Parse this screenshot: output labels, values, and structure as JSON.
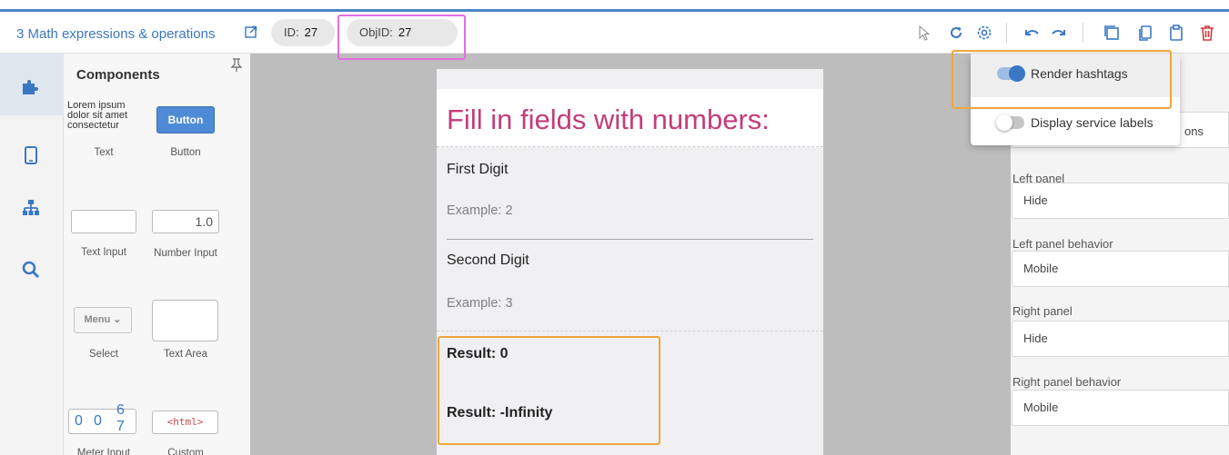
{
  "header": {
    "project_title": "3 Math expressions & operations",
    "id_label": "ID:",
    "id_value": "27",
    "objid_label": "ObjID:",
    "objid_value": "27"
  },
  "toolbar": {
    "icons": [
      "pointer-icon",
      "refresh-icon",
      "settings-gear-icon",
      "undo-icon",
      "redo-icon",
      "duplicate-icon",
      "copy-icon",
      "paste-icon",
      "delete-icon"
    ],
    "delete_color": "#d23b3b",
    "accent_color": "#3b78c4"
  },
  "rail": {
    "items": [
      "components-puzzle-icon",
      "device-mobile-icon",
      "hierarchy-icon",
      "search-icon"
    ]
  },
  "components": {
    "title": "Components",
    "text_sample": "Lorem ipsum dolor sit amet consectetur",
    "text_label": "Text",
    "button_sample": "Button",
    "button_label": "Button",
    "text_input_label": "Text Input",
    "number_input_sample": "1.0",
    "number_input_label": "Number Input",
    "select_sample": "Menu",
    "select_label": "Select",
    "text_area_label": "Text Area",
    "meter_digits": [
      "0",
      "0",
      "6",
      "7"
    ],
    "meter_label": "Meter Input",
    "custom_sample": "<html>",
    "custom_label": "Custom"
  },
  "canvas": {
    "heading": "Fill in fields with numbers:",
    "field1_label": "First Digit",
    "field1_placeholder": "Example: 2",
    "field2_label": "Second Digit",
    "field2_placeholder": "Example: 3",
    "result1": "Result: 0",
    "result2": "Result: -Infinity",
    "heading_color": "#c43d7a"
  },
  "popup": {
    "render_hashtags": "Render hashtags",
    "render_hashtags_on": true,
    "display_service_labels": "Display service labels",
    "display_service_labels_on": false
  },
  "properties": {
    "behind_popup_text": "ons",
    "left_panel_label": "Left panel",
    "left_panel_value": "Hide",
    "left_panel_behavior_label": "Left panel behavior",
    "left_panel_behavior_value": "Mobile",
    "right_panel_label": "Right panel",
    "right_panel_value": "Hide",
    "right_panel_behavior_label": "Right panel behavior",
    "right_panel_behavior_value": "Mobile"
  },
  "annotations": {
    "magenta": "#e26ee2",
    "orange": "#f0a53c"
  }
}
